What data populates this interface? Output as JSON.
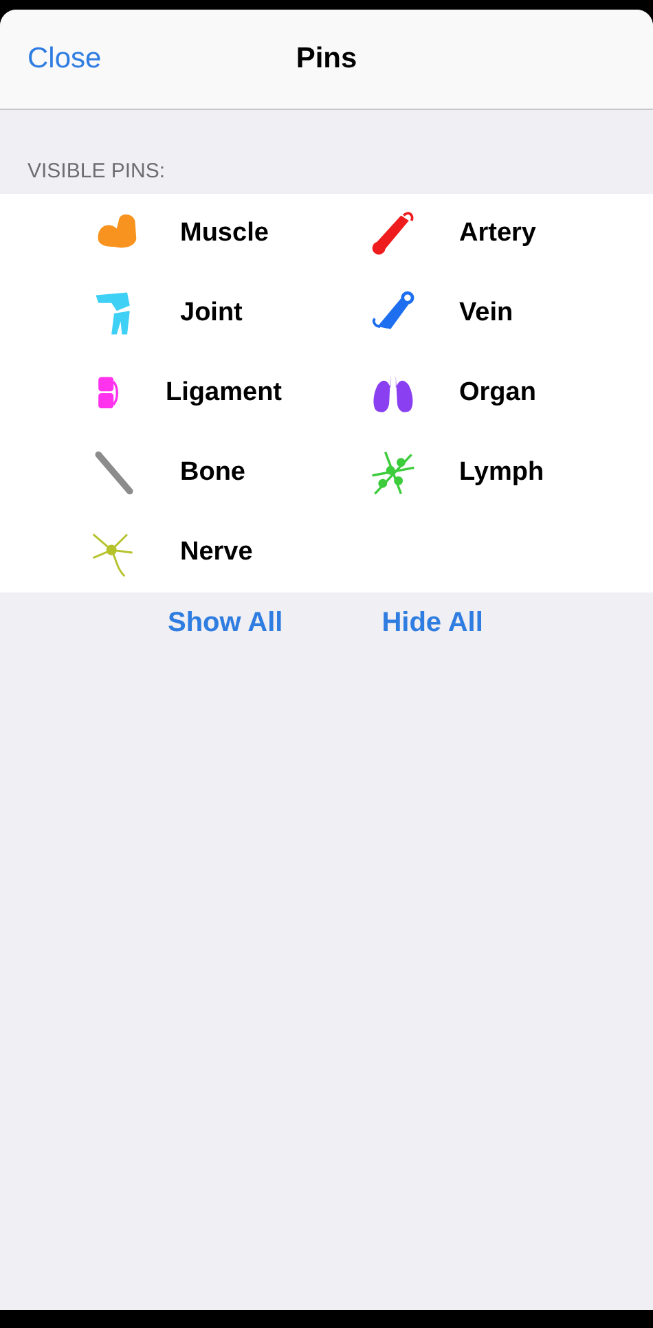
{
  "header": {
    "close": "Close",
    "title": "Pins"
  },
  "section_label": "VISIBLE PINS:",
  "pins": [
    {
      "label": "Muscle",
      "kind": "muscle",
      "color": "#f7931e"
    },
    {
      "label": "Artery",
      "kind": "artery",
      "color": "#ee1c1c"
    },
    {
      "label": "Joint",
      "kind": "joint",
      "color": "#3fd0f5"
    },
    {
      "label": "Vein",
      "kind": "vein",
      "color": "#1e6ff0"
    },
    {
      "label": "Ligament",
      "kind": "ligament",
      "color": "#ff33ee"
    },
    {
      "label": "Organ",
      "kind": "organ",
      "color": "#8a3ff0"
    },
    {
      "label": "Bone",
      "kind": "bone",
      "color": "#8c8c8c"
    },
    {
      "label": "Lymph",
      "kind": "lymph",
      "color": "#3ccc3c"
    },
    {
      "label": "Nerve",
      "kind": "nerve",
      "color": "#b5c22a"
    }
  ],
  "actions": [
    "Show All",
    "Hide All"
  ]
}
